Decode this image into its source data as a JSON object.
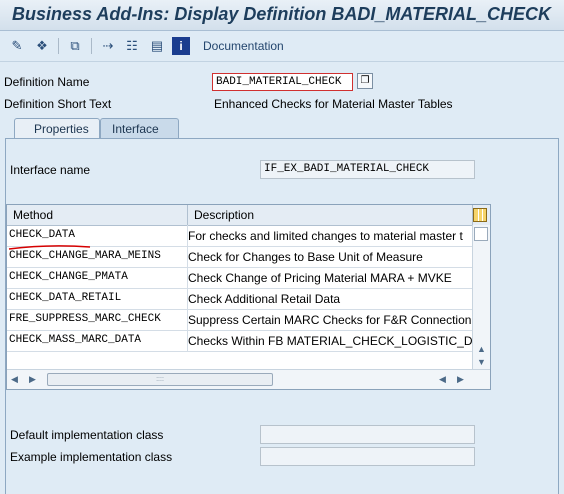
{
  "window": {
    "title": "Business Add-Ins: Display Definition BADI_MATERIAL_CHECK"
  },
  "toolbar": {
    "buttons": [
      {
        "icon": "change-display-icon"
      },
      {
        "icon": "other-object-icon"
      },
      {
        "icon": "where-used-icon"
      },
      {
        "icon": "navigate-icon"
      },
      {
        "icon": "hierarchy-icon"
      },
      {
        "icon": "print-icon"
      },
      {
        "icon": "info-icon"
      }
    ],
    "documentation_label": "Documentation"
  },
  "header": {
    "definition_name_label": "Definition Name",
    "definition_name_value": "BADI_MATERIAL_CHECK",
    "short_text_label": "Definition Short Text",
    "short_text_value": "Enhanced Checks for Material Master Tables"
  },
  "tabs": [
    {
      "label": "Properties",
      "active": false
    },
    {
      "label": "Interface",
      "active": true
    }
  ],
  "interface": {
    "name_label": "Interface name",
    "name_value": "IF_EX_BADI_MATERIAL_CHECK"
  },
  "methods_table": {
    "columns": [
      "Method",
      "Description"
    ],
    "rows": [
      {
        "method": "CHECK_DATA",
        "description": "For checks and limited changes to material master t"
      },
      {
        "method": "CHECK_CHANGE_MARA_MEINS",
        "description": "Check for Changes to Base Unit of Measure"
      },
      {
        "method": "CHECK_CHANGE_PMATA",
        "description": "Check Change of Pricing Material MARA + MVKE"
      },
      {
        "method": "CHECK_DATA_RETAIL",
        "description": "Check Additional Retail Data"
      },
      {
        "method": "FRE_SUPPRESS_MARC_CHECK",
        "description": "Suppress Certain MARC Checks for F&R Connection"
      },
      {
        "method": "CHECK_MASS_MARC_DATA",
        "description": "Checks Within FB MATERIAL_CHECK_LOGISTIC_DA"
      }
    ]
  },
  "implementation": {
    "default_label": "Default implementation class",
    "default_value": "",
    "example_label": "Example implementation class",
    "example_value": ""
  },
  "colors": {
    "accent": "#1d3d5c",
    "annotation": "#d60000"
  }
}
